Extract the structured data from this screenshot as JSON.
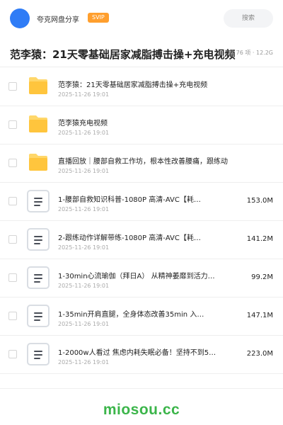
{
  "header": {
    "site_name": "夸克网盘分享",
    "svip_badge": "SVIP",
    "search_placeholder": "搜索",
    "avatar_color": "#2f7cf6"
  },
  "folder": {
    "title": "范李猿：21天零基础居家减脂搏击操+充电视频",
    "meta": "共 76 项 · 12.2G"
  },
  "colors": {
    "folder_yellow": "#ffc53d",
    "folder_tab": "#ffd76a",
    "svip_orange": "#ff9f2e",
    "watermark_green": "#3bb54a"
  },
  "items": [
    {
      "type": "folder",
      "icon": "folder-icon",
      "name": "范李猿：21天零基础居家减脂搏击操+充电视频",
      "date": "2025-11-26 19:01",
      "size": ""
    },
    {
      "type": "folder",
      "icon": "folder-icon",
      "name": "范李猿充电视频",
      "date": "2025-11-26 19:01",
      "size": ""
    },
    {
      "type": "folder",
      "icon": "folder-icon",
      "name": "直播回放｜腰部自救工作坊，根本性改善腰痛，跟练动作…",
      "date": "2025-11-26 19:01",
      "size": ""
    },
    {
      "type": "file",
      "icon": "document-icon",
      "name": "1-腰部自救知识科普-1080P 高清-AVC【耗…",
      "date": "2025-11-26 19:01",
      "size": "153.0M"
    },
    {
      "type": "file",
      "icon": "document-icon",
      "name": "2-跟练动作详解带练-1080P 高清-AVC【耗…",
      "date": "2025-11-26 19:01",
      "size": "141.2M"
    },
    {
      "type": "file",
      "icon": "document-icon",
      "name": "1-30min心流瑜伽（拜日A） 从精神萎靡到活力…",
      "date": "2025-11-26 19:01",
      "size": "99.2M"
    },
    {
      "type": "file",
      "icon": "document-icon",
      "name": "1-35min开肩直腿，全身体态改善35min 入…",
      "date": "2025-11-26 19:01",
      "size": "147.1M"
    },
    {
      "type": "file",
      "icon": "document-icon",
      "name": "1-2000w人看过 焦虑内耗失眠必备！坚持不到5…",
      "date": "2025-11-26 19:01",
      "size": "223.0M"
    }
  ],
  "footer": {
    "watermark": "miosou.cc"
  }
}
